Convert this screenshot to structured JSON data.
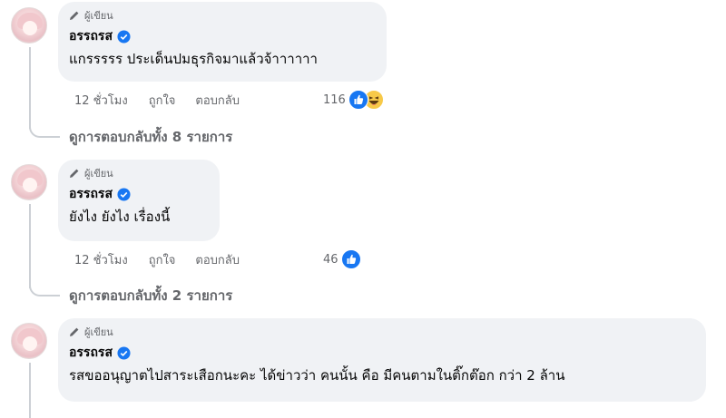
{
  "comments": [
    {
      "badge": "ผู้เขียน",
      "author": "อรรถรส",
      "text": "แกรรรรร ประเด็นปมธุรกิจมาแล้วจ้าาาาาา",
      "time": "12 ชั่วโมง",
      "like_label": "ถูกใจ",
      "reply_label": "ตอบกลับ",
      "reaction_count": "116",
      "reactions": [
        "like-icon",
        "haha-icon"
      ],
      "replies_link": "ดูการตอบกลับทั้ง 8 รายการ"
    },
    {
      "badge": "ผู้เขียน",
      "author": "อรรถรส",
      "text": "ยังไง ยังไง เรื่องนี้",
      "time": "12 ชั่วโมง",
      "like_label": "ถูกใจ",
      "reply_label": "ตอบกลับ",
      "reaction_count": "46",
      "reactions": [
        "like-icon"
      ],
      "replies_link": "ดูการตอบกลับทั้ง 2 รายการ"
    },
    {
      "badge": "ผู้เขียน",
      "author": "อรรถรส",
      "text": "รสขออนุญาตไปสาระเสือกนะคะ ได้ข่าวว่า คนนั้น คือ มีคนตามในติ๊กต๊อก กว่า 2 ล้าน"
    }
  ],
  "colors": {
    "bubble_bg": "#f0f2f5",
    "secondary_text": "#65676b",
    "like_blue": "#1877f2",
    "verified_blue": "#1877f2"
  }
}
